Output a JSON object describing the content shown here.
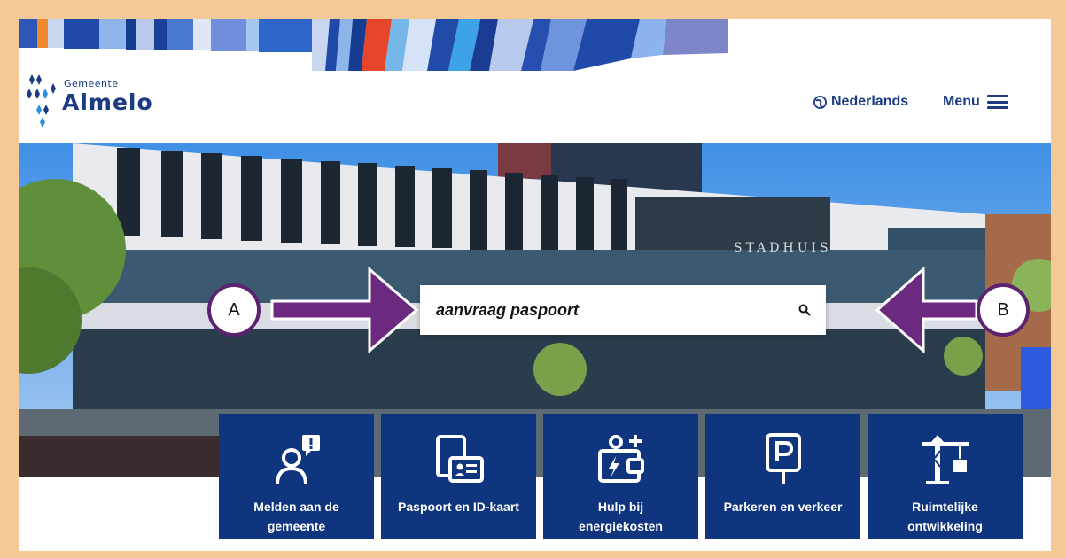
{
  "header": {
    "logo_small": "Gemeente",
    "logo_big": "Almelo",
    "language_label": "Nederlands",
    "menu_label": "Menu"
  },
  "hero": {
    "building_sign": "STADHUIS"
  },
  "search": {
    "value": "aanvraag paspoort"
  },
  "annotations": {
    "callout_a": "A",
    "callout_b": "B"
  },
  "tiles": [
    {
      "label": "Melden aan de gemeente",
      "icon": "report-person-icon"
    },
    {
      "label": "Paspoort en ID-kaart",
      "icon": "passport-id-icon"
    },
    {
      "label": "Hulp bij energiekosten",
      "icon": "energy-wallet-icon"
    },
    {
      "label": "Parkeren en verkeer",
      "icon": "parking-sign-icon"
    },
    {
      "label": "Ruimtelijke ontwikkeling",
      "icon": "crane-icon"
    }
  ],
  "colors": {
    "brand_blue": "#10357f",
    "frame": "#f4c996",
    "annotation_purple": "#5b2270"
  }
}
